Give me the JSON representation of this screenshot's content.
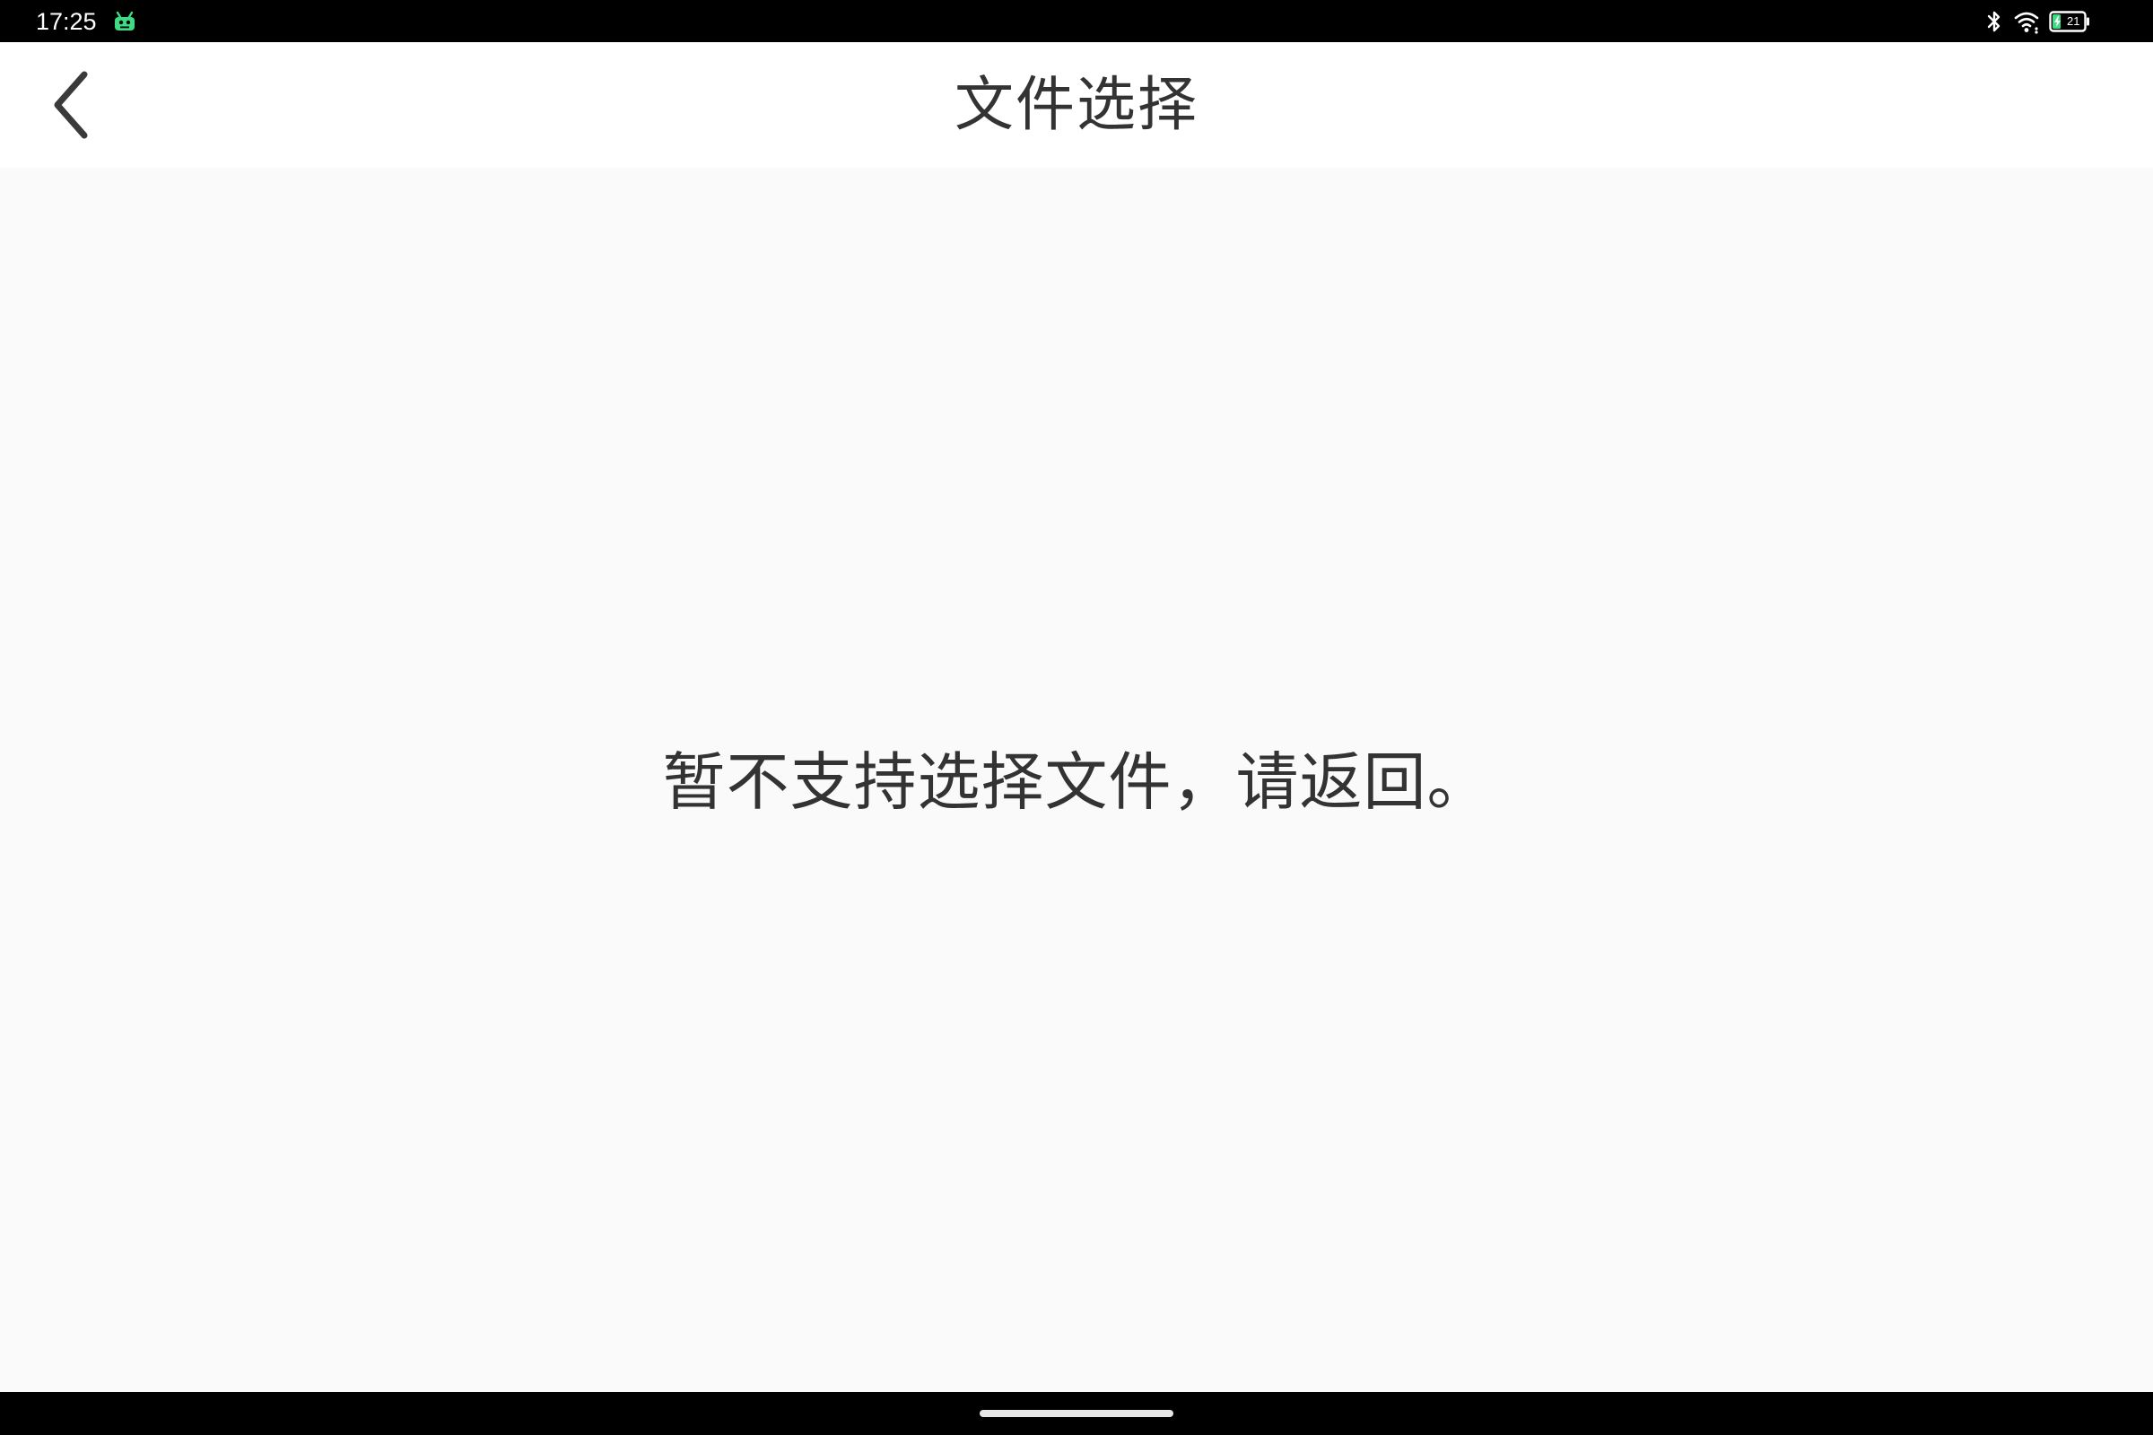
{
  "status_bar": {
    "time": "17:25",
    "battery_level": "21"
  },
  "app_bar": {
    "title": "文件选择"
  },
  "content": {
    "message": "暂不支持选择文件，请返回。"
  },
  "icons": {
    "back": "chevron-left-icon",
    "app_notification": "android-icon",
    "bluetooth": "bluetooth-icon",
    "wifi": "wifi-icon",
    "battery": "battery-charging-icon"
  },
  "colors": {
    "status_bar_bg": "#000000",
    "app_bar_bg": "#ffffff",
    "content_bg": "#fafafa",
    "text": "#333333",
    "app_icon_green": "#3ddc84"
  }
}
